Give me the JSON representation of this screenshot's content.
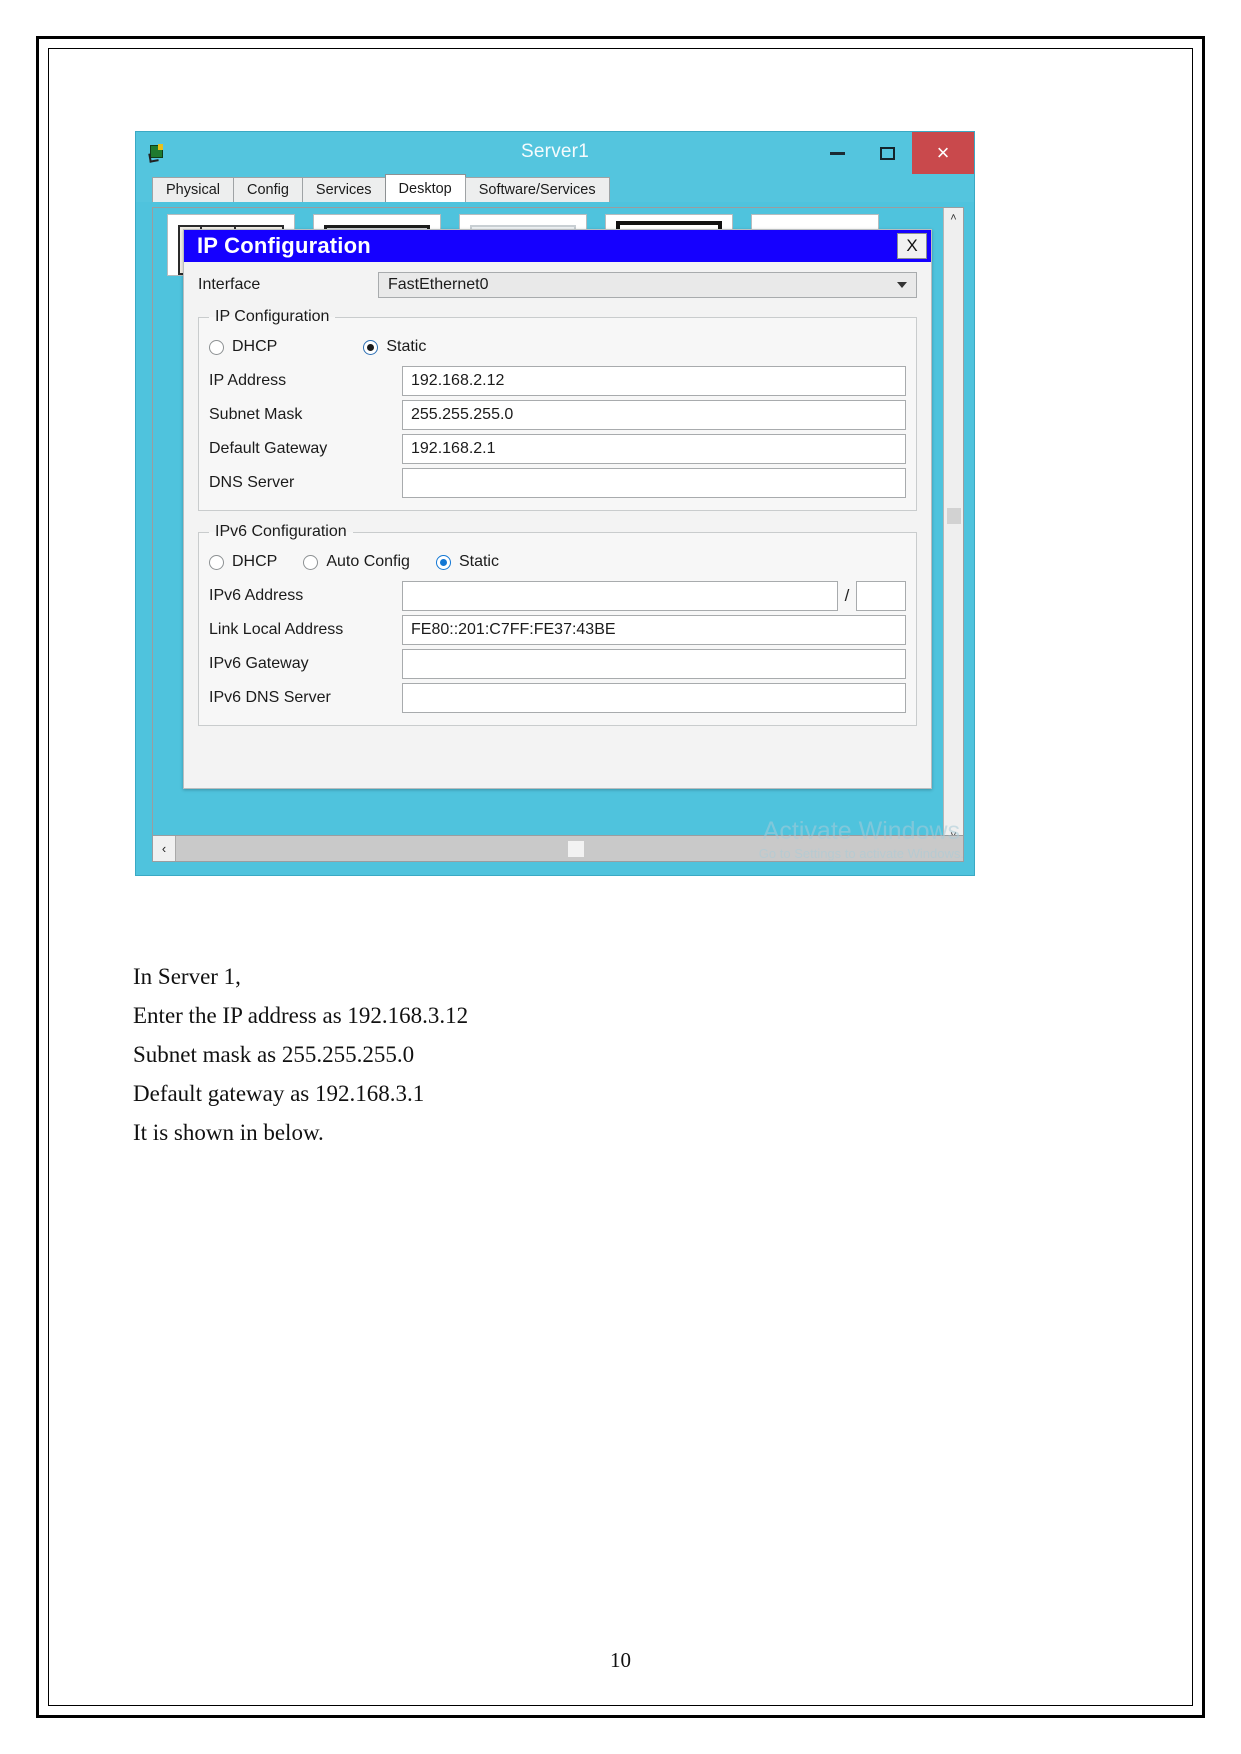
{
  "window": {
    "title": "Server1",
    "app_icon": "packet-tracer-icon",
    "buttons": {
      "minimize": "–",
      "maximize": "▭",
      "close": "×"
    },
    "tabs": [
      {
        "label": "Physical",
        "active": false
      },
      {
        "label": "Config",
        "active": false
      },
      {
        "label": "Services",
        "active": false
      },
      {
        "label": "Desktop",
        "active": true
      },
      {
        "label": "Software/Services",
        "active": false
      }
    ],
    "scroll": {
      "left_arrow": "‹",
      "right_arrow": "›",
      "up_arrow": "˄",
      "down_arrow": "˅"
    }
  },
  "watermark": {
    "line1": "Activate Windows",
    "line2": "Go to Settings to activate Windows."
  },
  "dialog": {
    "title": "IP Configuration",
    "close_label": "X",
    "interface": {
      "label": "Interface",
      "value": "FastEthernet0"
    },
    "ipv4": {
      "legend": "IP Configuration",
      "modes": [
        {
          "label": "DHCP",
          "selected": false
        },
        {
          "label": "Static",
          "selected": true
        }
      ],
      "fields": [
        {
          "label": "IP Address",
          "value": "192.168.2.12"
        },
        {
          "label": "Subnet Mask",
          "value": "255.255.255.0"
        },
        {
          "label": "Default Gateway",
          "value": "192.168.2.1"
        },
        {
          "label": "DNS Server",
          "value": ""
        }
      ]
    },
    "ipv6": {
      "legend": "IPv6 Configuration",
      "modes": [
        {
          "label": "DHCP",
          "selected": false
        },
        {
          "label": "Auto Config",
          "selected": false
        },
        {
          "label": "Static",
          "selected": true
        }
      ],
      "address_label": "IPv6 Address",
      "address_value": "",
      "prefix_separator": "/",
      "prefix_value": "",
      "fields": [
        {
          "label": "Link Local Address",
          "value": "FE80::201:C7FF:FE37:43BE"
        },
        {
          "label": "IPv6 Gateway",
          "value": ""
        },
        {
          "label": "IPv6 DNS Server",
          "value": ""
        }
      ]
    }
  },
  "document": {
    "lines": [
      "In Server 1,",
      "Enter the IP address as 192.168.3.12",
      "Subnet mask as 255.255.255.0",
      "Default gateway as 192.168.3.1",
      "It is shown in below."
    ],
    "page_number": "10"
  },
  "colors": {
    "window_chrome": "#54c5de",
    "dialog_title": "#1500ff",
    "close_button": "#c9494c",
    "radio_selected_blue": "#1277d4"
  }
}
